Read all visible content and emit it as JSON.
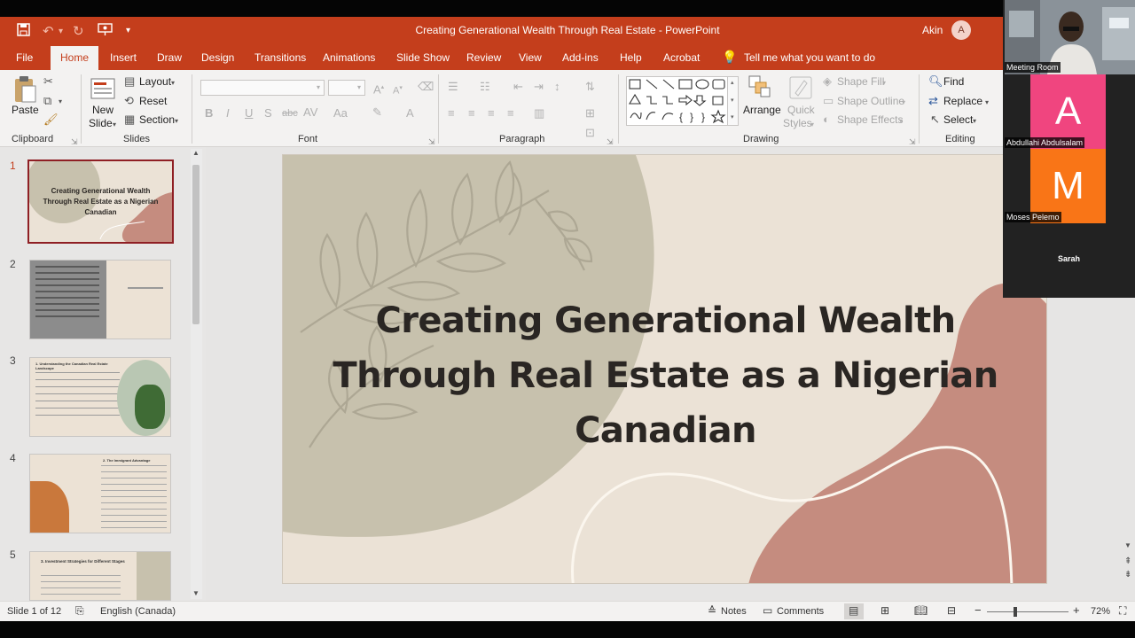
{
  "window": {
    "title": "Creating Generational Wealth Through Real Estate as a Nigerian Canadian - PowerPoint",
    "title_short": "Creating Generational Wealth Through Real Estate  -  PowerPoint",
    "user_name": "Akin",
    "user_initial": "A"
  },
  "menu": {
    "tabs": [
      "File",
      "Home",
      "Insert",
      "Draw",
      "Design",
      "Transitions",
      "Animations",
      "Slide Show",
      "Review",
      "View",
      "Add-ins",
      "Help",
      "Acrobat"
    ],
    "tell_me": "Tell me what you want to do"
  },
  "ribbon": {
    "clipboard": {
      "label": "Clipboard",
      "paste": "Paste"
    },
    "slides": {
      "label": "Slides",
      "new_slide_line1": "New",
      "new_slide_line2": "Slide",
      "layout": "Layout",
      "reset": "Reset",
      "section": "Section"
    },
    "font": {
      "label": "Font"
    },
    "paragraph": {
      "label": "Paragraph"
    },
    "drawing": {
      "label": "Drawing",
      "arrange": "Arrange",
      "quick_styles_line1": "Quick",
      "quick_styles_line2": "Styles",
      "shape_fill": "Shape Fill",
      "shape_outline": "Shape Outline",
      "shape_effects": "Shape Effects"
    },
    "editing": {
      "label": "Editing",
      "find": "Find",
      "replace": "Replace",
      "select": "Select"
    }
  },
  "thumbnails": [
    {
      "number": "1",
      "title": "Creating Generational Wealth Through Real Estate as a Nigerian Canadian"
    },
    {
      "number": "2"
    },
    {
      "number": "3",
      "title": "1. Understanding the Canadian Real Estate Landscape"
    },
    {
      "number": "4",
      "title": "2. The Immigrant Advantage"
    },
    {
      "number": "5",
      "title": "3. Investment Strategies for Different Stages"
    }
  ],
  "slide": {
    "title_line1": "Creating Generational Wealth",
    "title_line2": "Through Real Estate as a Nigerian",
    "title_line3": "Canadian"
  },
  "status": {
    "slide_counter": "Slide 1 of 12",
    "language": "English (Canada)",
    "notes": "Notes",
    "comments": "Comments",
    "zoom": "72%"
  },
  "video": {
    "participants": [
      {
        "name": "Meeting Room"
      },
      {
        "name": "Abdullahi Abdulsalam",
        "initial": "A",
        "color": "#f0457f"
      },
      {
        "name": "Moses Pelemo",
        "initial": "M",
        "color": "#f97517"
      },
      {
        "name": "Sarah"
      }
    ]
  },
  "colors": {
    "accent": "#c43e1c",
    "selected_thumb_border": "#8f1f24",
    "slide_bg": "#ebe2d6",
    "olive_blob": "#c7c1ad",
    "rose_blob": "#c58c7f"
  },
  "icons": [
    "save-icon",
    "undo-icon",
    "redo-icon",
    "present-icon",
    "customize-icon",
    "lightbulb-icon",
    "paste-icon",
    "cut-icon",
    "copy-icon",
    "format-painter-icon",
    "find-icon",
    "replace-icon",
    "select-icon"
  ]
}
